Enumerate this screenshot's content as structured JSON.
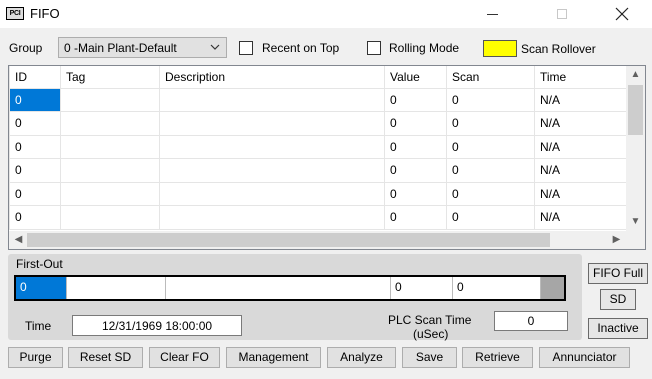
{
  "window": {
    "icon_text": "PCI",
    "title": "FIFO"
  },
  "controls": {
    "group_label": "Group",
    "group_value": "0 -Main Plant-Default",
    "recent_on_top": "Recent on Top",
    "rolling_mode": "Rolling Mode",
    "scan_rollover": "Scan Rollover",
    "scan_rollover_color": "#ffff00"
  },
  "grid": {
    "columns": [
      "ID",
      "Tag",
      "Description",
      "Value",
      "Scan",
      "Time"
    ],
    "rows": [
      [
        "0",
        "",
        "",
        "0",
        "0",
        "N/A"
      ],
      [
        "0",
        "",
        "",
        "0",
        "0",
        "N/A"
      ],
      [
        "0",
        "",
        "",
        "0",
        "0",
        "N/A"
      ],
      [
        "0",
        "",
        "",
        "0",
        "0",
        "N/A"
      ],
      [
        "0",
        "",
        "",
        "0",
        "0",
        "N/A"
      ],
      [
        "0",
        "",
        "",
        "0",
        "0",
        "N/A"
      ]
    ],
    "selection_color": "#0078d7"
  },
  "first_out": {
    "label": "First-Out",
    "id": "0",
    "tag": "",
    "description": "",
    "value": "0",
    "scan": "0",
    "time_label": "Time",
    "time_value": "12/31/1969 18:00:00",
    "plc_scan_label": "PLC Scan Time",
    "plc_scan_unit": "(uSec)",
    "plc_scan_value": "0"
  },
  "status_buttons": {
    "fifo_full": "FIFO Full",
    "sd": "SD",
    "inactive": "Inactive"
  },
  "buttons": {
    "purge": "Purge",
    "reset_sd": "Reset SD",
    "clear_fo": "Clear FO",
    "management": "Management",
    "analyze": "Analyze",
    "save": "Save",
    "retrieve": "Retrieve",
    "annunciator": "Annunciator"
  }
}
